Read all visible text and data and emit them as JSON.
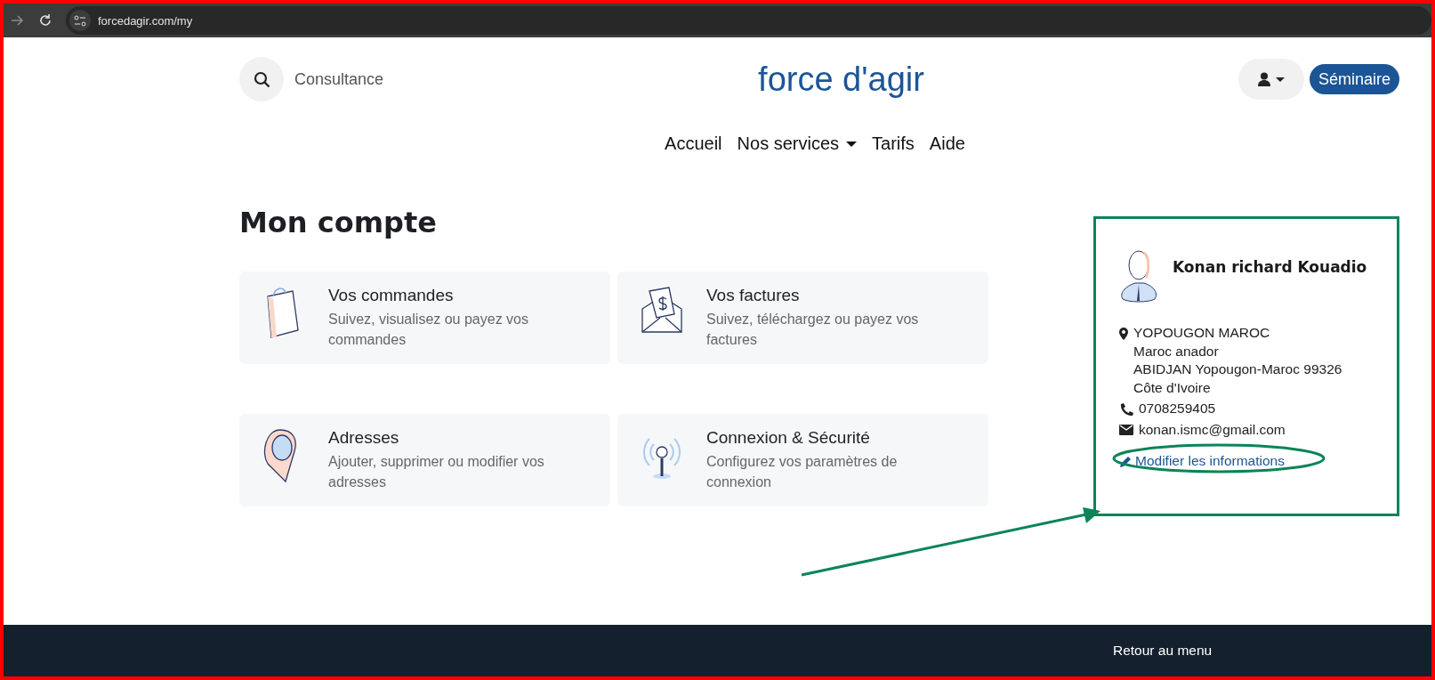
{
  "browser": {
    "url": "forcedagir.com/my"
  },
  "header": {
    "search_label": "Consultance",
    "logo": "force d'agir",
    "seminar_button": "Séminaire"
  },
  "nav": [
    {
      "label": "Accueil",
      "kind": "link"
    },
    {
      "label": "Nos services",
      "kind": "dropdown"
    },
    {
      "label": "Tarifs",
      "kind": "link"
    },
    {
      "label": "Aide",
      "kind": "link"
    }
  ],
  "title": "Mon compte",
  "cards": [
    {
      "kind": "bag",
      "title": "Vos commandes",
      "text": "Suivez, visualisez ou payez vos commandes"
    },
    {
      "kind": "invoice",
      "title": "Vos factures",
      "text": "Suivez, téléchargez ou payez vos factures"
    },
    {
      "kind": "pin",
      "title": "Adresses",
      "text": "Ajouter, supprimer ou modifier vos adresses"
    },
    {
      "kind": "antenna",
      "title": "Connexion & Sécurité",
      "text": "Configurez vos paramètres de connexion"
    }
  ],
  "profile": {
    "name": "Konan richard Kouadio",
    "address": [
      "YOPOUGON MAROC",
      "Maroc anador",
      "ABIDJAN Yopougon-Maroc 99326",
      "Côte d'Ivoire"
    ],
    "phone": "0708259405",
    "email": "konan.ismc@gmail.com",
    "edit_link": "Modifier les informations"
  },
  "footer": {
    "link": "Retour au menu"
  }
}
